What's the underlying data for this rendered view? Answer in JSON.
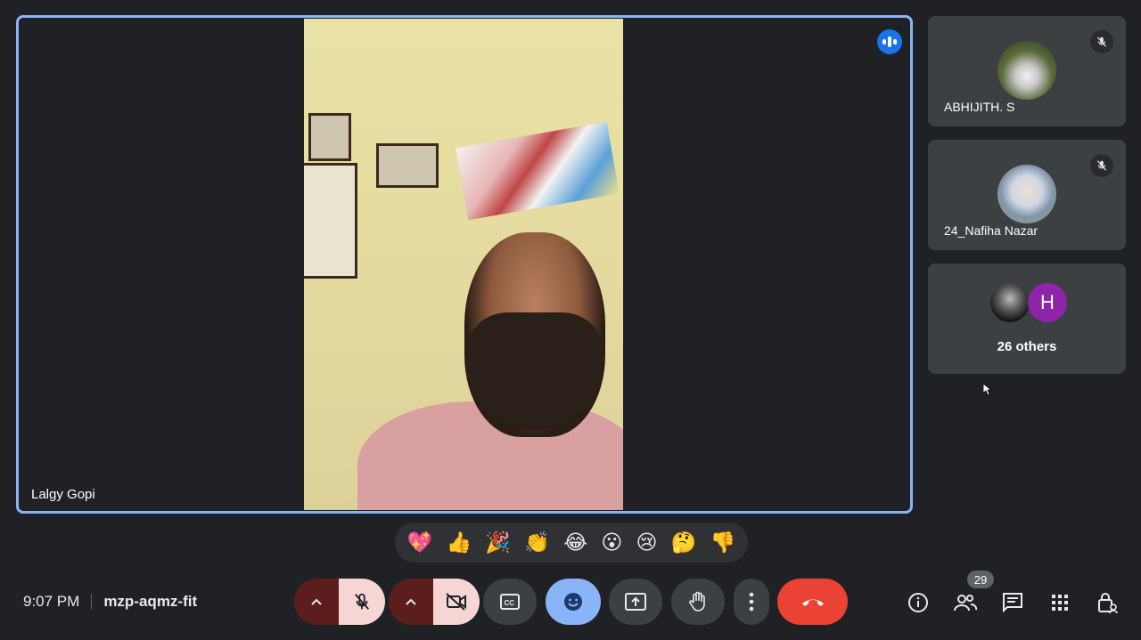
{
  "stage": {
    "speaker_name": "Lalgy Gopi"
  },
  "tiles": [
    {
      "name": "ABHIJITH. S",
      "muted": true
    },
    {
      "name": "24_Nafiha Nazar",
      "muted": true
    }
  ],
  "others": {
    "label": "26 others",
    "avatar_letter": "H"
  },
  "reactions": [
    "💖",
    "👍",
    "🎉",
    "👏",
    "😂",
    "😮",
    "😢",
    "🤔",
    "👎"
  ],
  "footer": {
    "time": "9:07 PM",
    "meeting_code": "mzp-aqmz-fit",
    "people_count": "29"
  },
  "controls": [
    "mic-off-icon",
    "camera-off-icon",
    "captions-icon",
    "emoji-icon",
    "present-icon",
    "raise-hand-icon",
    "more-options-icon",
    "end-call-icon"
  ],
  "colors": {
    "accent": "#8ab4f8",
    "end_call": "#ea4335",
    "active": "#8ab4f8",
    "mic_off_bg": "#f6d6d5"
  }
}
